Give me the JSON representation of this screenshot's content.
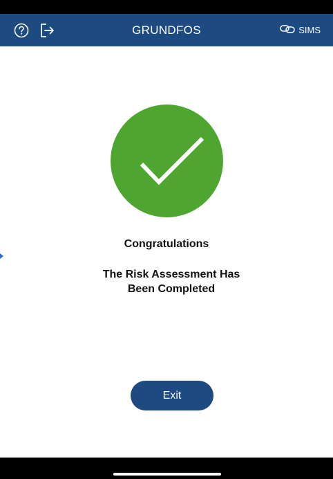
{
  "header": {
    "title": "GRUNDFOS",
    "sims_label": "SIMS",
    "background": "#1d4a80",
    "icons": {
      "help": "help-circle-icon",
      "logout": "logout-icon",
      "link": "link-icon"
    }
  },
  "success": {
    "icon": "checkmark-icon",
    "circle_color": "#4ea52f"
  },
  "message": {
    "title": "Congratulations",
    "line1": "The Risk Assessment Has",
    "line2": "Been Completed"
  },
  "actions": {
    "exit_label": "Exit"
  }
}
